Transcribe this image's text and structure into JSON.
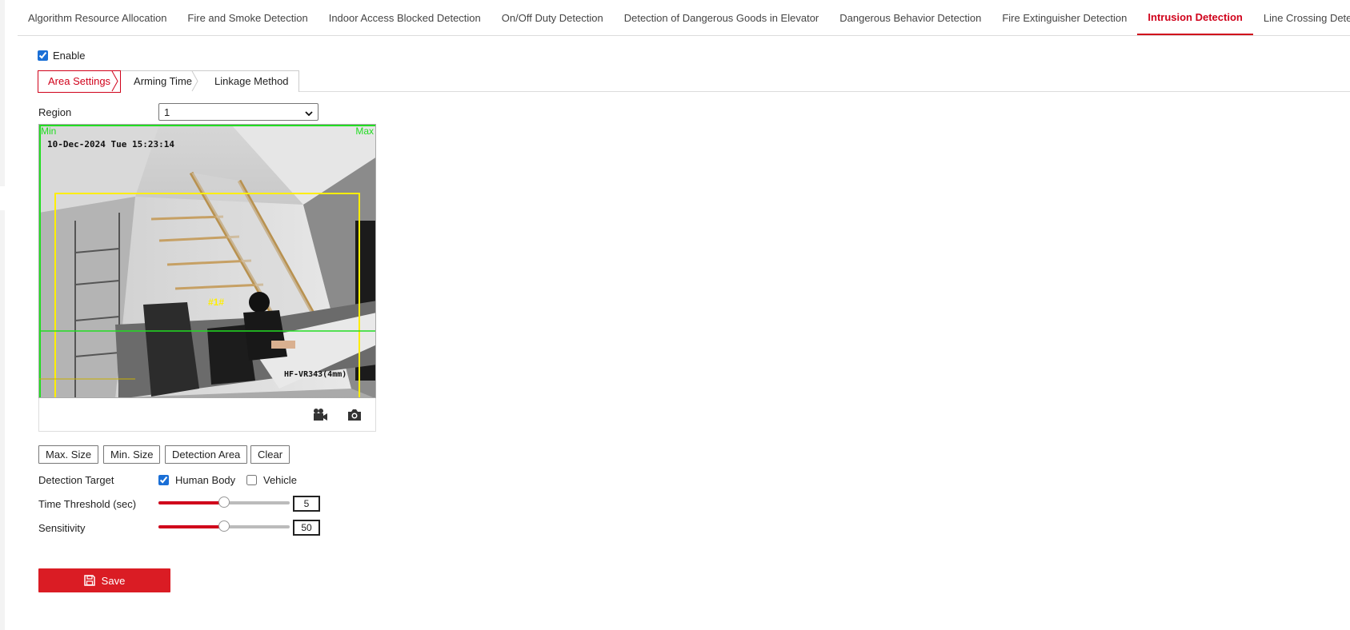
{
  "top_tabs": [
    {
      "label": "Algorithm Resource Allocation",
      "active": false
    },
    {
      "label": "Fire and Smoke Detection",
      "active": false
    },
    {
      "label": "Indoor Access Blocked Detection",
      "active": false
    },
    {
      "label": "On/Off Duty Detection",
      "active": false
    },
    {
      "label": "Detection of Dangerous Goods in Elevator",
      "active": false
    },
    {
      "label": "Dangerous Behavior Detection",
      "active": false
    },
    {
      "label": "Fire Extinguisher Detection",
      "active": false
    },
    {
      "label": "Intrusion Detection",
      "active": true
    },
    {
      "label": "Line Crossing Detection",
      "active": false
    }
  ],
  "enable": {
    "label": "Enable",
    "checked": true
  },
  "sub_tabs": [
    {
      "label": "Area Settings",
      "active": true
    },
    {
      "label": "Arming Time",
      "active": false
    },
    {
      "label": "Linkage Method",
      "active": false
    }
  ],
  "region": {
    "label": "Region",
    "value": "1"
  },
  "video": {
    "osd_time": "10-Dec-2024 Tue 15:23:14",
    "min_label": "Min",
    "max_label": "Max",
    "area_label": "#1#",
    "camera_model": "HF-VR343(4mm)"
  },
  "toolbar": {
    "record_icon": "video-record-icon",
    "capture_icon": "camera-icon"
  },
  "buttons": {
    "max_size": "Max. Size",
    "min_size": "Min. Size",
    "detection_area": "Detection Area",
    "clear": "Clear"
  },
  "detection_target": {
    "label": "Detection Target",
    "human": {
      "label": "Human Body",
      "checked": true
    },
    "vehicle": {
      "label": "Vehicle",
      "checked": false
    }
  },
  "time_threshold": {
    "label": "Time Threshold (sec)",
    "value": "5",
    "fraction": 0.5
  },
  "sensitivity": {
    "label": "Sensitivity",
    "value": "50",
    "fraction": 0.5
  },
  "save": {
    "label": "Save"
  },
  "colors": {
    "accent": "#d0021b",
    "save_bg": "#da1c24",
    "zone": "#ffee00",
    "minmax": "#22dd22"
  }
}
